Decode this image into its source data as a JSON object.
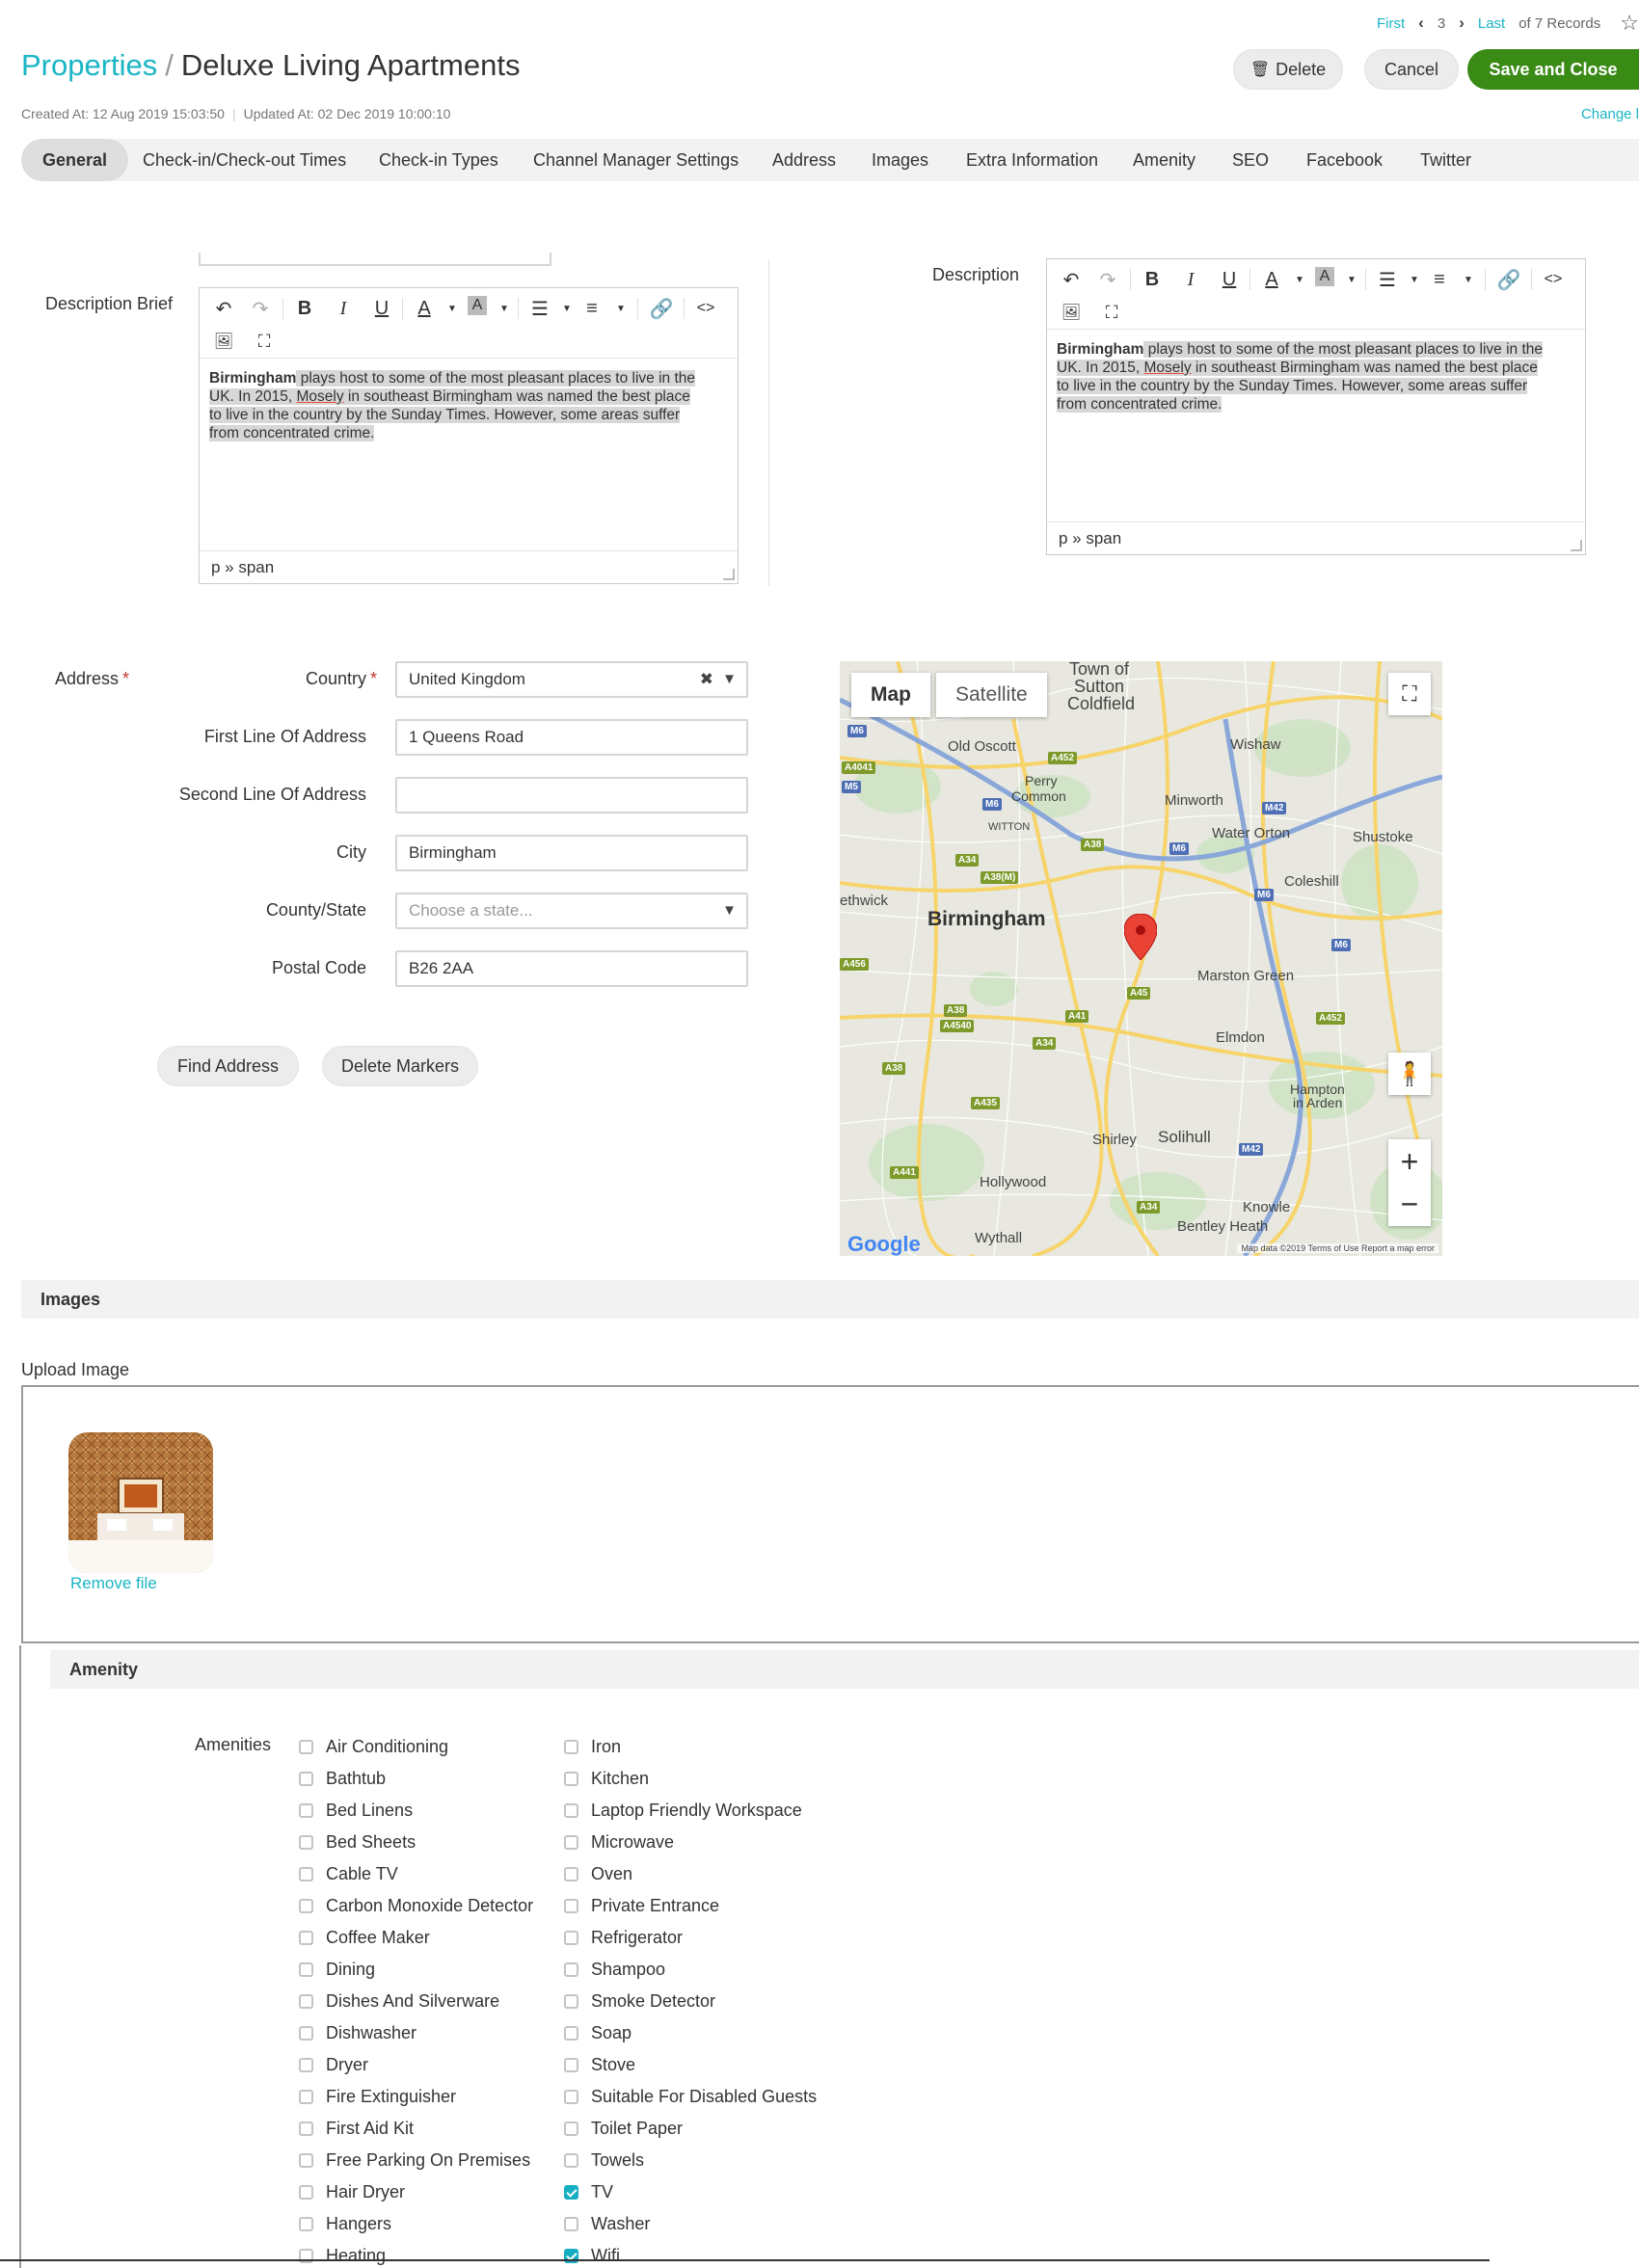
{
  "pager": {
    "first": "First",
    "current": "3",
    "last": "Last",
    "total": "of 7 Records"
  },
  "breadcrumb": {
    "parent": "Properties",
    "separator": "/",
    "title": "Deluxe Living Apartments"
  },
  "meta": {
    "created": "Created At: 12 Aug 2019 15:03:50",
    "updated": "Updated At: 02 Dec 2019 10:00:10"
  },
  "actions": {
    "delete": "Delete",
    "cancel": "Cancel",
    "save_close": "Save and Close",
    "change": "Change l"
  },
  "tabs": [
    "General",
    "Check-in/Check-out Times",
    "Check-in Types",
    "Channel Manager Settings",
    "Address",
    "Images",
    "Extra Information",
    "Amenity",
    "SEO",
    "Facebook",
    "Twitter"
  ],
  "description_brief": {
    "label": "Description Brief",
    "bold": "Birmingham",
    "line1": " plays host to some of the most pleasant places to live in the",
    "line2a": "UK. In 2015, ",
    "line2b": "Mosely",
    "line2c": " in southeast Birmingham was named the best place",
    "line3": "to live in the country by the Sunday Times. However, some areas suffer",
    "line4": "from concentrated crime.",
    "path": "p » span"
  },
  "description": {
    "label": "Description",
    "bold": "Birmingham",
    "line1": " plays host to some of the most pleasant places to live in the",
    "line2a": "UK. In 2015, ",
    "line2b": "Mosely",
    "line2c": " in southeast Birmingham was named the best place",
    "line3": "to live in the country by the Sunday Times. However, some areas suffer",
    "line4": "from concentrated crime.",
    "path": "p » span"
  },
  "address": {
    "section_label": "Address",
    "country_label": "Country",
    "country_value": "United Kingdom",
    "line1_label": "First Line Of Address",
    "line1_value": "1  Queens Road",
    "line2_label": "Second Line Of Address",
    "line2_value": "",
    "city_label": "City",
    "city_value": "Birmingham",
    "state_label": "County/State",
    "state_placeholder": "Choose a state...",
    "postal_label": "Postal Code",
    "postal_value": "B26 2AA",
    "find_button": "Find Address",
    "delete_markers_button": "Delete Markers"
  },
  "map": {
    "tab_map": "Map",
    "tab_satellite": "Satellite",
    "places": [
      "Town of",
      "Sutton",
      "Coldfield",
      "Old Oscott",
      "Wishaw",
      "Perry",
      "Common",
      "WITTON",
      "Minworth",
      "Water Orton",
      "Shustoke",
      "Coleshill",
      "ethwick",
      "Birmingham",
      "Marston Green",
      "Elmdon",
      "Hampton",
      "in Arden",
      "Shirley",
      "Solihull",
      "Hollywood",
      "Knowle",
      "Bentley Heath",
      "Wythall"
    ],
    "roads": [
      "M6",
      "A452",
      "A4041",
      "M5",
      "M6",
      "A38",
      "A34",
      "A38(M)",
      "M6",
      "M42",
      "M6",
      "M6",
      "A456",
      "A45",
      "A38",
      "A4540",
      "A41",
      "A34",
      "A452",
      "A38",
      "A435",
      "M42",
      "A441",
      "A34"
    ],
    "attribution": "Map data ©2019   Terms of Use   Report a map error",
    "google": "Google",
    "zoom_in": "+",
    "zoom_out": "−"
  },
  "images": {
    "section_title": "Images",
    "upload_label": "Upload Image",
    "remove_file": "Remove file"
  },
  "amenity": {
    "section_title": "Amenity",
    "label": "Amenities",
    "col1": [
      {
        "name": "Air Conditioning",
        "checked": false
      },
      {
        "name": "Bathtub",
        "checked": false
      },
      {
        "name": "Bed Linens",
        "checked": false
      },
      {
        "name": "Bed Sheets",
        "checked": false
      },
      {
        "name": "Cable TV",
        "checked": false
      },
      {
        "name": "Carbon Monoxide Detector",
        "checked": false
      },
      {
        "name": "Coffee Maker",
        "checked": false
      },
      {
        "name": "Dining",
        "checked": false
      },
      {
        "name": "Dishes And Silverware",
        "checked": false
      },
      {
        "name": "Dishwasher",
        "checked": false
      },
      {
        "name": "Dryer",
        "checked": false
      },
      {
        "name": "Fire Extinguisher",
        "checked": false
      },
      {
        "name": "First Aid Kit",
        "checked": false
      },
      {
        "name": "Free Parking On Premises",
        "checked": false
      },
      {
        "name": "Hair Dryer",
        "checked": false
      },
      {
        "name": "Hangers",
        "checked": false
      },
      {
        "name": "Heating",
        "checked": false
      }
    ],
    "col2": [
      {
        "name": "Iron",
        "checked": false
      },
      {
        "name": "Kitchen",
        "checked": false
      },
      {
        "name": "Laptop Friendly Workspace",
        "checked": false
      },
      {
        "name": "Microwave",
        "checked": false
      },
      {
        "name": "Oven",
        "checked": false
      },
      {
        "name": "Private Entrance",
        "checked": false
      },
      {
        "name": "Refrigerator",
        "checked": false
      },
      {
        "name": "Shampoo",
        "checked": false
      },
      {
        "name": "Smoke Detector",
        "checked": false
      },
      {
        "name": "Soap",
        "checked": false
      },
      {
        "name": "Stove",
        "checked": false
      },
      {
        "name": "Suitable For Disabled Guests",
        "checked": false
      },
      {
        "name": "Toilet Paper",
        "checked": false
      },
      {
        "name": "Towels",
        "checked": false
      },
      {
        "name": "TV",
        "checked": true
      },
      {
        "name": "Washer",
        "checked": false
      },
      {
        "name": "Wifi",
        "checked": true
      }
    ]
  },
  "colors": {
    "accent": "#1ab5c5",
    "save": "#3a8a16",
    "checkbox_on": "#16aec2",
    "required": "#c0392b"
  }
}
